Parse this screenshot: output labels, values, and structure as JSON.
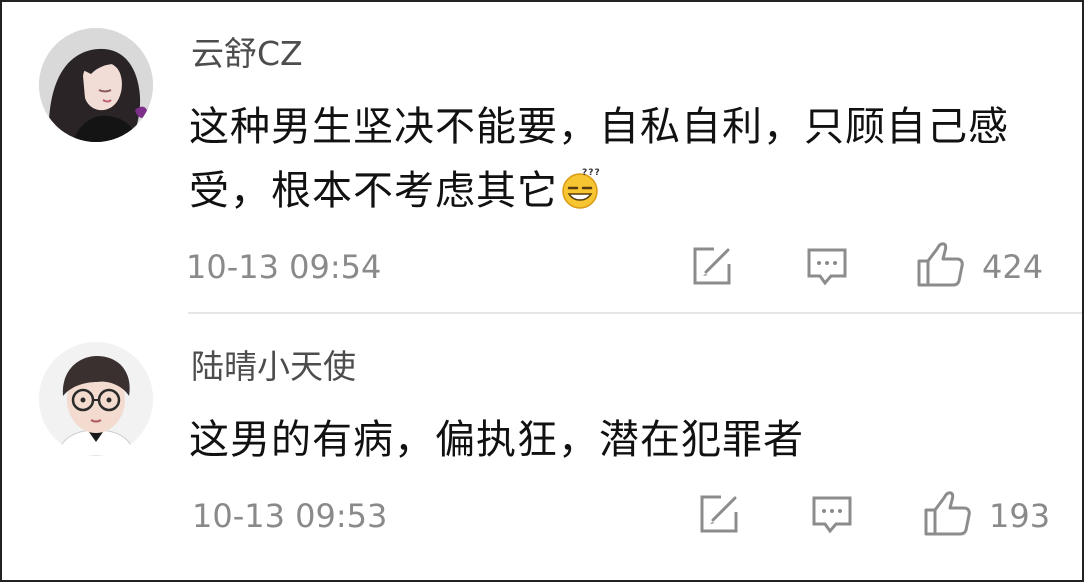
{
  "comments": [
    {
      "avatar_icon": "girl-portrait-avatar",
      "username": "云舒CZ",
      "text": "这种男生坚决不能要，自私自利，只顾自己感受，根本不考虑其它",
      "emoji": "dizzy-grin-emoji",
      "timestamp": "10-13 09:54",
      "likes": "424",
      "icons": [
        "repost-icon",
        "comment-icon",
        "like-icon"
      ]
    },
    {
      "avatar_icon": "boy-with-glasses-avatar",
      "username": "陆晴小天使",
      "text": "这男的有病，偏执狂，潜在犯罪者",
      "timestamp": "10-13 09:53",
      "likes": "193",
      "icons": [
        "repost-icon",
        "comment-icon",
        "like-icon"
      ]
    }
  ],
  "colors": {
    "username": "#4d4d4d",
    "text": "#111111",
    "meta": "#8a8a8a",
    "icon": "#8c8c8c",
    "divider": "#e6e6e6",
    "border": "#222222"
  }
}
